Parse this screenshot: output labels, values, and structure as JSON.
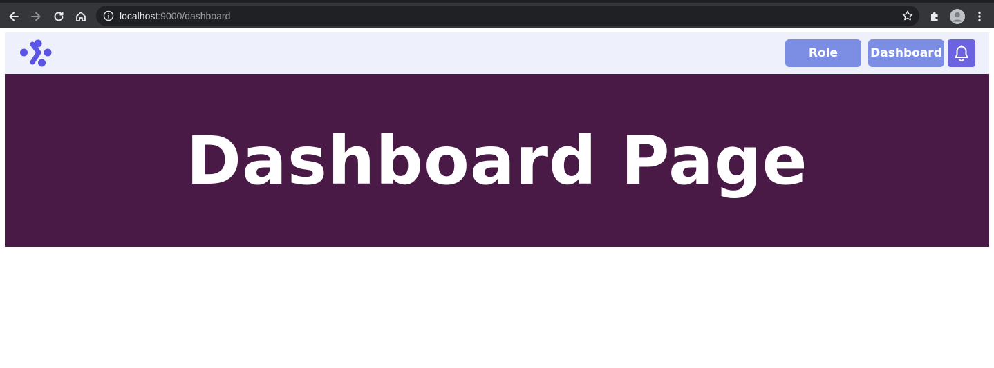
{
  "browser": {
    "url_host": "localhost",
    "url_path": ":9000/dashboard"
  },
  "header": {
    "role_label": "Role",
    "dashboard_label": "Dashboard"
  },
  "hero": {
    "title": "Dashboard Page"
  },
  "colors": {
    "header_bg": "#eef0fb",
    "button_bg": "#7b8ee3",
    "bell_bg": "#6b63e0",
    "hero_bg": "#4a1a47",
    "logo": "#5b55e6"
  },
  "icons": [
    "back-icon",
    "forward-icon",
    "reload-icon",
    "home-icon",
    "info-icon",
    "star-icon",
    "extensions-icon",
    "profile-icon",
    "menu-icon",
    "logo-icon",
    "bell-icon"
  ]
}
